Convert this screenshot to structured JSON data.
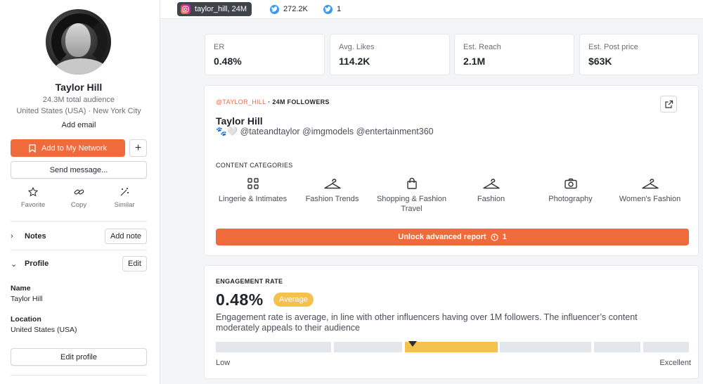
{
  "profile": {
    "name": "Taylor Hill",
    "audience": "24.3M total audience",
    "location": "United States (USA) · New York City",
    "add_email": "Add email",
    "add_network_label": "Add to My Network",
    "plus_label": "+",
    "send_message_label": "Send message...",
    "actions": [
      {
        "label": "Favorite",
        "icon": "star-icon"
      },
      {
        "label": "Copy",
        "icon": "link-icon"
      },
      {
        "label": "Similar",
        "icon": "magic-wand-icon"
      }
    ]
  },
  "notes": {
    "title": "Notes",
    "button": "Add note"
  },
  "profile_section": {
    "title": "Profile",
    "button": "Edit",
    "fields": [
      {
        "label": "Name",
        "value": "Taylor Hill"
      },
      {
        "label": "Location",
        "value": "United States (USA)"
      }
    ],
    "edit_profile_label": "Edit profile"
  },
  "platforms": [
    {
      "label": "taylor_hill,  24M",
      "icon": "instagram-icon",
      "active": true
    },
    {
      "label": "272.2K",
      "icon": "twitter-icon",
      "active": false
    },
    {
      "label": "1",
      "icon": "twitter-icon",
      "active": false
    }
  ],
  "stats": [
    {
      "label": "ER",
      "value": "0.48%"
    },
    {
      "label": "Avg. Likes",
      "value": "114.2K"
    },
    {
      "label": "Est. Reach",
      "value": "2.1M"
    },
    {
      "label": "Est. Post price",
      "value": "$63K"
    }
  ],
  "account": {
    "handle": "@TAYLOR_HILL",
    "followers": " · 24M FOLLOWERS",
    "name": "Taylor Hill",
    "bio": "🐾🤍 @tateandtaylor @imgmodels @entertainment360"
  },
  "content_categories": {
    "title": "CONTENT CATEGORIES",
    "items": [
      {
        "label": "Lingerie & Intimates",
        "icon": "grid-icon"
      },
      {
        "label": "Fashion Trends",
        "icon": "hanger-icon"
      },
      {
        "label": "Shopping & Fashion Travel",
        "icon": "shopping-bag-icon"
      },
      {
        "label": "Fashion",
        "icon": "hanger-icon"
      },
      {
        "label": "Photography",
        "icon": "camera-icon"
      },
      {
        "label": "Women's Fashion",
        "icon": "hanger-icon"
      }
    ]
  },
  "unlock": {
    "label": "Unlock advanced report",
    "credits": "1"
  },
  "engagement": {
    "title": "ENGAGEMENT RATE",
    "value": "0.48%",
    "badge": "Average",
    "description": "Engagement rate is average, in line with other influencers having over 1M followers. The influencer’s content moderately appeals to their audience",
    "low_label": "Low",
    "high_label": "Excellent"
  },
  "colors": {
    "accent": "#ef6b3b",
    "average": "#f5c14d",
    "twitter": "#3b9be8"
  }
}
